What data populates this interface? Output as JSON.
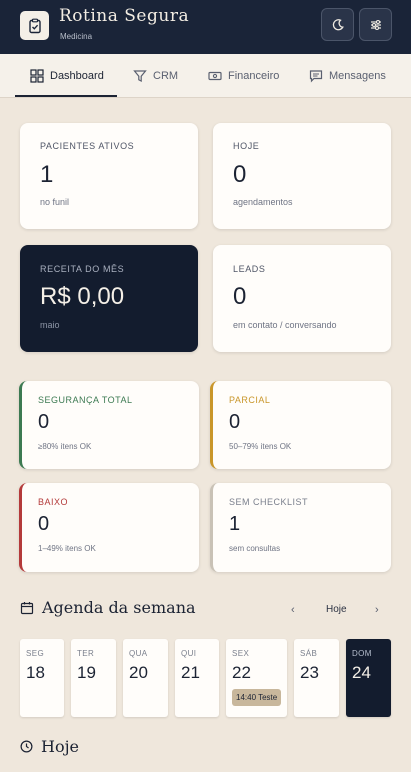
{
  "header": {
    "title": "Rotina Segura",
    "subtitle": "Medicina"
  },
  "tabs": [
    {
      "label": "Dashboard",
      "icon": "grid-icon",
      "active": true
    },
    {
      "label": "CRM",
      "icon": "filter-icon"
    },
    {
      "label": "Financeiro",
      "icon": "cash-icon"
    },
    {
      "label": "Mensagens",
      "icon": "message-icon"
    }
  ],
  "stats": [
    {
      "label": "PACIENTES ATIVOS",
      "value": "1",
      "desc": "no funil"
    },
    {
      "label": "HOJE",
      "value": "0",
      "desc": "agendamentos"
    },
    {
      "label": "RECEITA DO MÊS",
      "value": "R$ 0,00",
      "desc": "maio"
    },
    {
      "label": "LEADS",
      "value": "0",
      "desc": "em contato / conversando"
    }
  ],
  "security": [
    {
      "label": "SEGURANÇA TOTAL",
      "value": "0",
      "desc": "≥80% itens OK",
      "color": "#3c7a52"
    },
    {
      "label": "PARCIAL",
      "value": "0",
      "desc": "50–79% itens OK",
      "color": "#c9962a"
    },
    {
      "label": "BAIXO",
      "value": "0",
      "desc": "1–49% itens OK",
      "color": "#b43a3a"
    },
    {
      "label": "SEM CHECKLIST",
      "value": "1",
      "desc": "sem consultas",
      "color": "#c9c2b6"
    }
  ],
  "agenda": {
    "title": "Agenda da semana",
    "prev": "‹",
    "today_label": "Hoje",
    "next": "›",
    "days": [
      {
        "name": "SEG",
        "num": "18"
      },
      {
        "name": "TER",
        "num": "19"
      },
      {
        "name": "QUA",
        "num": "20"
      },
      {
        "name": "QUI",
        "num": "21"
      },
      {
        "name": "SEX",
        "num": "22",
        "event": "14:40 Teste"
      },
      {
        "name": "SÁB",
        "num": "23"
      },
      {
        "name": "DOM",
        "num": "24",
        "active": true
      }
    ]
  },
  "today_section": {
    "title": "Hoje"
  }
}
